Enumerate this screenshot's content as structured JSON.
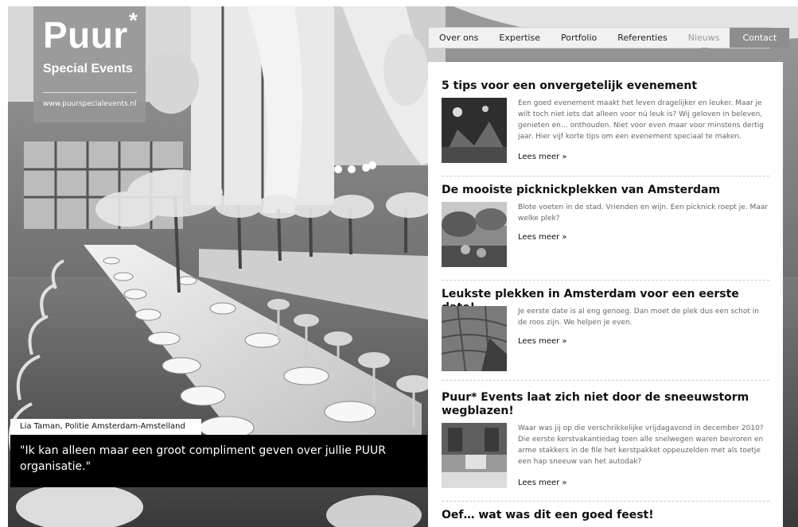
{
  "logo": {
    "name": "Puur",
    "star": "*",
    "tagline": "Special Events",
    "url": "www.puurspecialevents.nl"
  },
  "nav": {
    "items": [
      "Over ons",
      "Expertise",
      "Portfolio",
      "Referenties",
      "Nieuws"
    ],
    "active": "Nieuws",
    "contact": "Contact"
  },
  "articles": [
    {
      "title": "5 tips voor een onvergetelijk evenement",
      "text": "Een goed evenement maakt het leven dragelijker en leuker. Maar je wilt toch niet iets dat alleen voor nú leuk is? Wij geloven in beleven, genieten en… onthouden. Niet voor even maar voor minstens dertig jaar. Hier vijf korte tips om een evenement speciaal te maken.",
      "more": "Lees meer »"
    },
    {
      "title": "De mooiste picknickplekken van Amsterdam",
      "text": "Blote voeten in de stad. Vrienden en wijn. Een picknick roept je. Maar welke plek?",
      "more": "Lees meer »"
    },
    {
      "title": "Leukste plekken in Amsterdam voor een eerste date!",
      "text": "Je eerste date is al eng genoeg. Dan moet de plek dus een schot in de roos zijn. We helpen je even.",
      "more": "Lees meer »"
    },
    {
      "title": "Puur* Events laat zich niet door de sneeuwstorm wegblazen!",
      "text": "Waar was jij op die verschrikkelijke vrijdagavond in december 2010? Die eerste kerstvakantiedag toen alle snelwegen waren bevroren en arme stakkers in de file het kerstpakket oppeuzelden met als toetje een hap sneeuw van het autodak?",
      "more": "Lees meer »"
    },
    {
      "title": "Oef… wat was dit een goed feest!"
    }
  ],
  "testimonial": {
    "author": "Lia Taman, Politie Amsterdam-Amstelland",
    "quote": "\"Ik kan alleen maar een groot compliment geven over jullie PUUR organisatie.\""
  }
}
